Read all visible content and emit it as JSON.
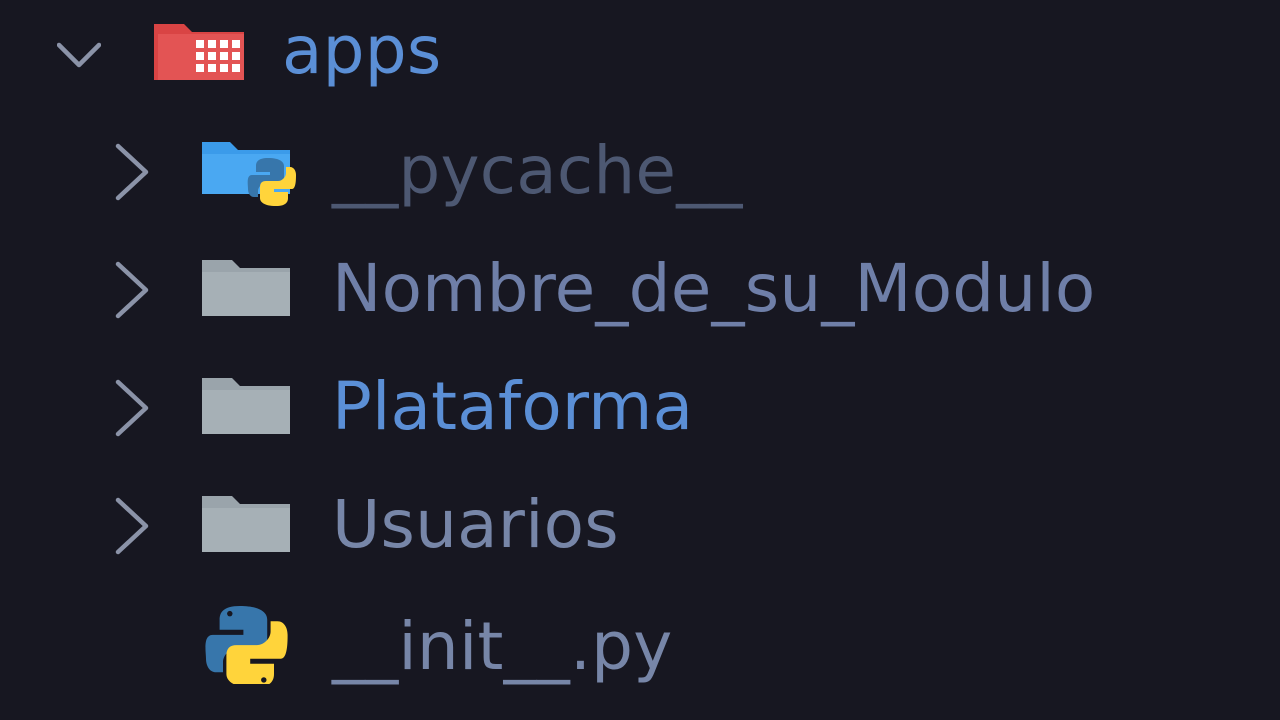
{
  "explorer": {
    "root": {
      "label": "apps",
      "expanded": true,
      "icon": "folder-apps-open-icon",
      "color": "#5b8fd6"
    },
    "items": [
      {
        "label": "__pycache__",
        "type": "folder",
        "icon": "folder-python-icon",
        "expanded": false,
        "color": "#4d5872"
      },
      {
        "label": "Nombre_de_su_Modulo",
        "type": "folder",
        "icon": "folder-icon",
        "expanded": false,
        "color": "#6f7fa8"
      },
      {
        "label": "Plataforma",
        "type": "folder",
        "icon": "folder-icon",
        "expanded": false,
        "color": "#5b8fd6"
      },
      {
        "label": "Usuarios",
        "type": "folder",
        "icon": "folder-icon",
        "expanded": false,
        "color": "#7786a8"
      },
      {
        "label": "__init__.py",
        "type": "file",
        "icon": "python-file-icon",
        "color": "#7786a8"
      }
    ]
  }
}
